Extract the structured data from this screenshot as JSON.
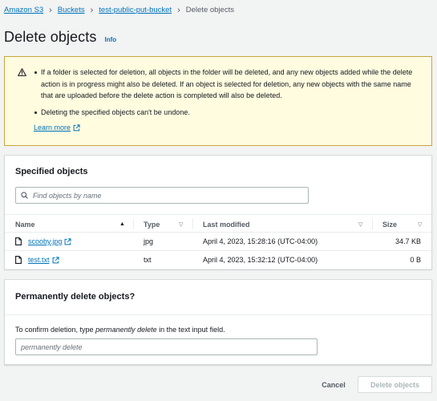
{
  "breadcrumb": {
    "items": [
      "Amazon S3",
      "Buckets",
      "test-public-put-bucket"
    ],
    "current": "Delete objects"
  },
  "page": {
    "title": "Delete objects",
    "info_label": "Info"
  },
  "warning": {
    "bullets": [
      "If a folder is selected for deletion, all objects in the folder will be deleted, and any new objects added while the delete action is in progress might also be deleted. If an object is selected for deletion, any new objects with the same name that are uploaded before the delete action is completed will also be deleted.",
      "Deleting the specified objects can't be undone."
    ],
    "learn_more": "Learn more"
  },
  "objects_panel": {
    "title": "Specified objects",
    "search_placeholder": "Find objects by name",
    "columns": [
      "Name",
      "Type",
      "Last modified",
      "Size"
    ],
    "rows": [
      {
        "name": "scooby.jpg",
        "type": "jpg",
        "last_modified": "April 4, 2023, 15:28:16 (UTC-04:00)",
        "size": "34.7 KB"
      },
      {
        "name": "test.txt",
        "type": "txt",
        "last_modified": "April 4, 2023, 15:32:12 (UTC-04:00)",
        "size": "0 B"
      }
    ]
  },
  "confirm_panel": {
    "title": "Permanently delete objects?",
    "instruction_prefix": "To confirm deletion, type ",
    "instruction_keyword": "permanently delete",
    "instruction_suffix": " in the text input field.",
    "input_placeholder": "permanently delete",
    "input_value": ""
  },
  "actions": {
    "cancel": "Cancel",
    "delete": "Delete objects"
  },
  "colors": {
    "link": "#0073bb",
    "warning_bg": "#fffce0",
    "warning_border": "#c9a640",
    "page_bg": "#f2f3f3"
  },
  "icons": {
    "warning": "warning-triangle-icon",
    "external": "external-link-icon",
    "search": "search-icon",
    "file": "file-icon",
    "sort_asc": "caret-up-icon",
    "sort": "caret-down-icon"
  }
}
